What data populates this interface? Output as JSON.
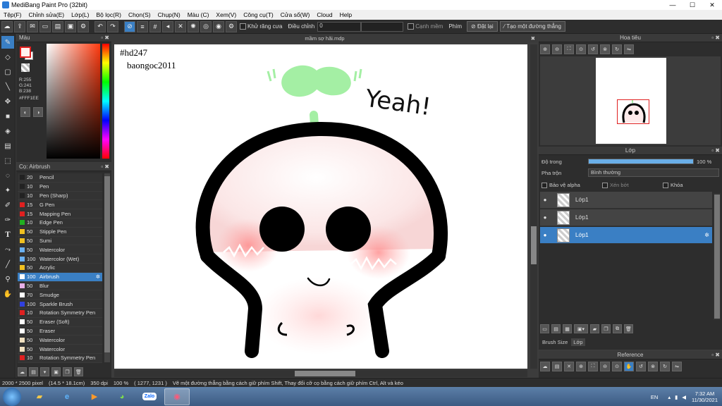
{
  "window": {
    "title": "MediBang Paint Pro (32bit)"
  },
  "menu": [
    "Tệp(F)",
    "Chỉnh sửa(E)",
    "Lớp(L)",
    "Bộ lọc(R)",
    "Chọn(S)",
    "Chụp(N)",
    "Màu (C)",
    "Xem(V)",
    "Công cụ(T)",
    "Cửa sổ(W)",
    "Cloud",
    "Help"
  ],
  "toolbar": {
    "antialias_label": "Khử răng cưa",
    "correction_label": "Điều chỉnh",
    "correction_value": "0",
    "smooth_label": "Cạnh mềm",
    "key_label": "Phím",
    "reset_label": "Đặt lại",
    "straight_line_label": "Tạo một đường thẳng"
  },
  "color_panel": {
    "title": "Màu",
    "r": "R:255",
    "g": "G:241",
    "b": "B:238",
    "hex": "#FFF1EE",
    "fg_color": "#FFF1EE"
  },
  "brush_panel": {
    "title": "Cọ: Airbrush",
    "items": [
      {
        "size": "20",
        "name": "Pencil",
        "color": "#222222"
      },
      {
        "size": "10",
        "name": "Pen",
        "color": "#222222"
      },
      {
        "size": "10",
        "name": "Pen (Sharp)",
        "color": "#222222"
      },
      {
        "size": "15",
        "name": "G Pen",
        "color": "#e02020"
      },
      {
        "size": "15",
        "name": "Mapping Pen",
        "color": "#e02020"
      },
      {
        "size": "10",
        "name": "Edge Pen",
        "color": "#20b020"
      },
      {
        "size": "50",
        "name": "Stipple Pen",
        "color": "#f0c020"
      },
      {
        "size": "50",
        "name": "Sumi",
        "color": "#f0c020"
      },
      {
        "size": "50",
        "name": "Watercolor",
        "color": "#6ab0f0"
      },
      {
        "size": "100",
        "name": "Watercolor (Wet)",
        "color": "#6ab0f0"
      },
      {
        "size": "50",
        "name": "Acrylic",
        "color": "#f0c020"
      },
      {
        "size": "100",
        "name": "Airbrush",
        "color": "#ffffff",
        "selected": true
      },
      {
        "size": "50",
        "name": "Blur",
        "color": "#e8b0e8"
      },
      {
        "size": "70",
        "name": "Smudge",
        "color": "#ffffff"
      },
      {
        "size": "100",
        "name": "Sparkle Brush",
        "color": "#3040e0"
      },
      {
        "size": "10",
        "name": "Rotation Symmetry Pen",
        "color": "#e02020"
      },
      {
        "size": "50",
        "name": "Eraser (Soft)",
        "color": "#ffffff"
      },
      {
        "size": "50",
        "name": "Eraser",
        "color": "#ffffff"
      },
      {
        "size": "50",
        "name": "Watercolor",
        "color": "#f0e0c0"
      },
      {
        "size": "50",
        "name": "Watercolor",
        "color": "#f0e0c0"
      },
      {
        "size": "10",
        "name": "Rotation Symmetry Pen",
        "color": "#e02020"
      }
    ]
  },
  "document": {
    "tab": "mầm sợ hãi.mdp"
  },
  "artwork": {
    "line1": "#hd247",
    "line2": "baongoc2011",
    "word": "Yeah!"
  },
  "navigator": {
    "title": "Hoa tiêu"
  },
  "layer_panel": {
    "title": "Lớp",
    "opacity_label": "Độ trong",
    "opacity_value": "100 %",
    "opacity_fraction": 1.0,
    "blend_label": "Pha trộn",
    "blend_value": "Bình thường",
    "protect_alpha": "Bảo vệ alpha",
    "clipping": "Xén bớt",
    "lock": "Khóa",
    "layers": [
      {
        "name": "Lớp1",
        "selected": false
      },
      {
        "name": "Lớp1",
        "selected": false
      },
      {
        "name": "Lớp1",
        "selected": true
      }
    ],
    "tab_brush_size": "Brush Size",
    "tab_layer": "Lớp"
  },
  "reference": {
    "title": "Reference"
  },
  "status": {
    "dimensions": "2000 * 2500 pixel",
    "physical": "(14.5 * 18.1cm)",
    "dpi": "350 dpi",
    "zoom": "100 %",
    "coords": "( 1277, 1231 )",
    "hint": "Vẽ một đường thẳng bằng cách giữ phím Shift, Thay đổi cỡ cọ bằng cách giữ phím Ctrl, Alt và kéo"
  },
  "taskbar": {
    "lang": "EN",
    "time": "7:32 AM",
    "date": "11/30/2021",
    "zalo": "Zalo"
  }
}
